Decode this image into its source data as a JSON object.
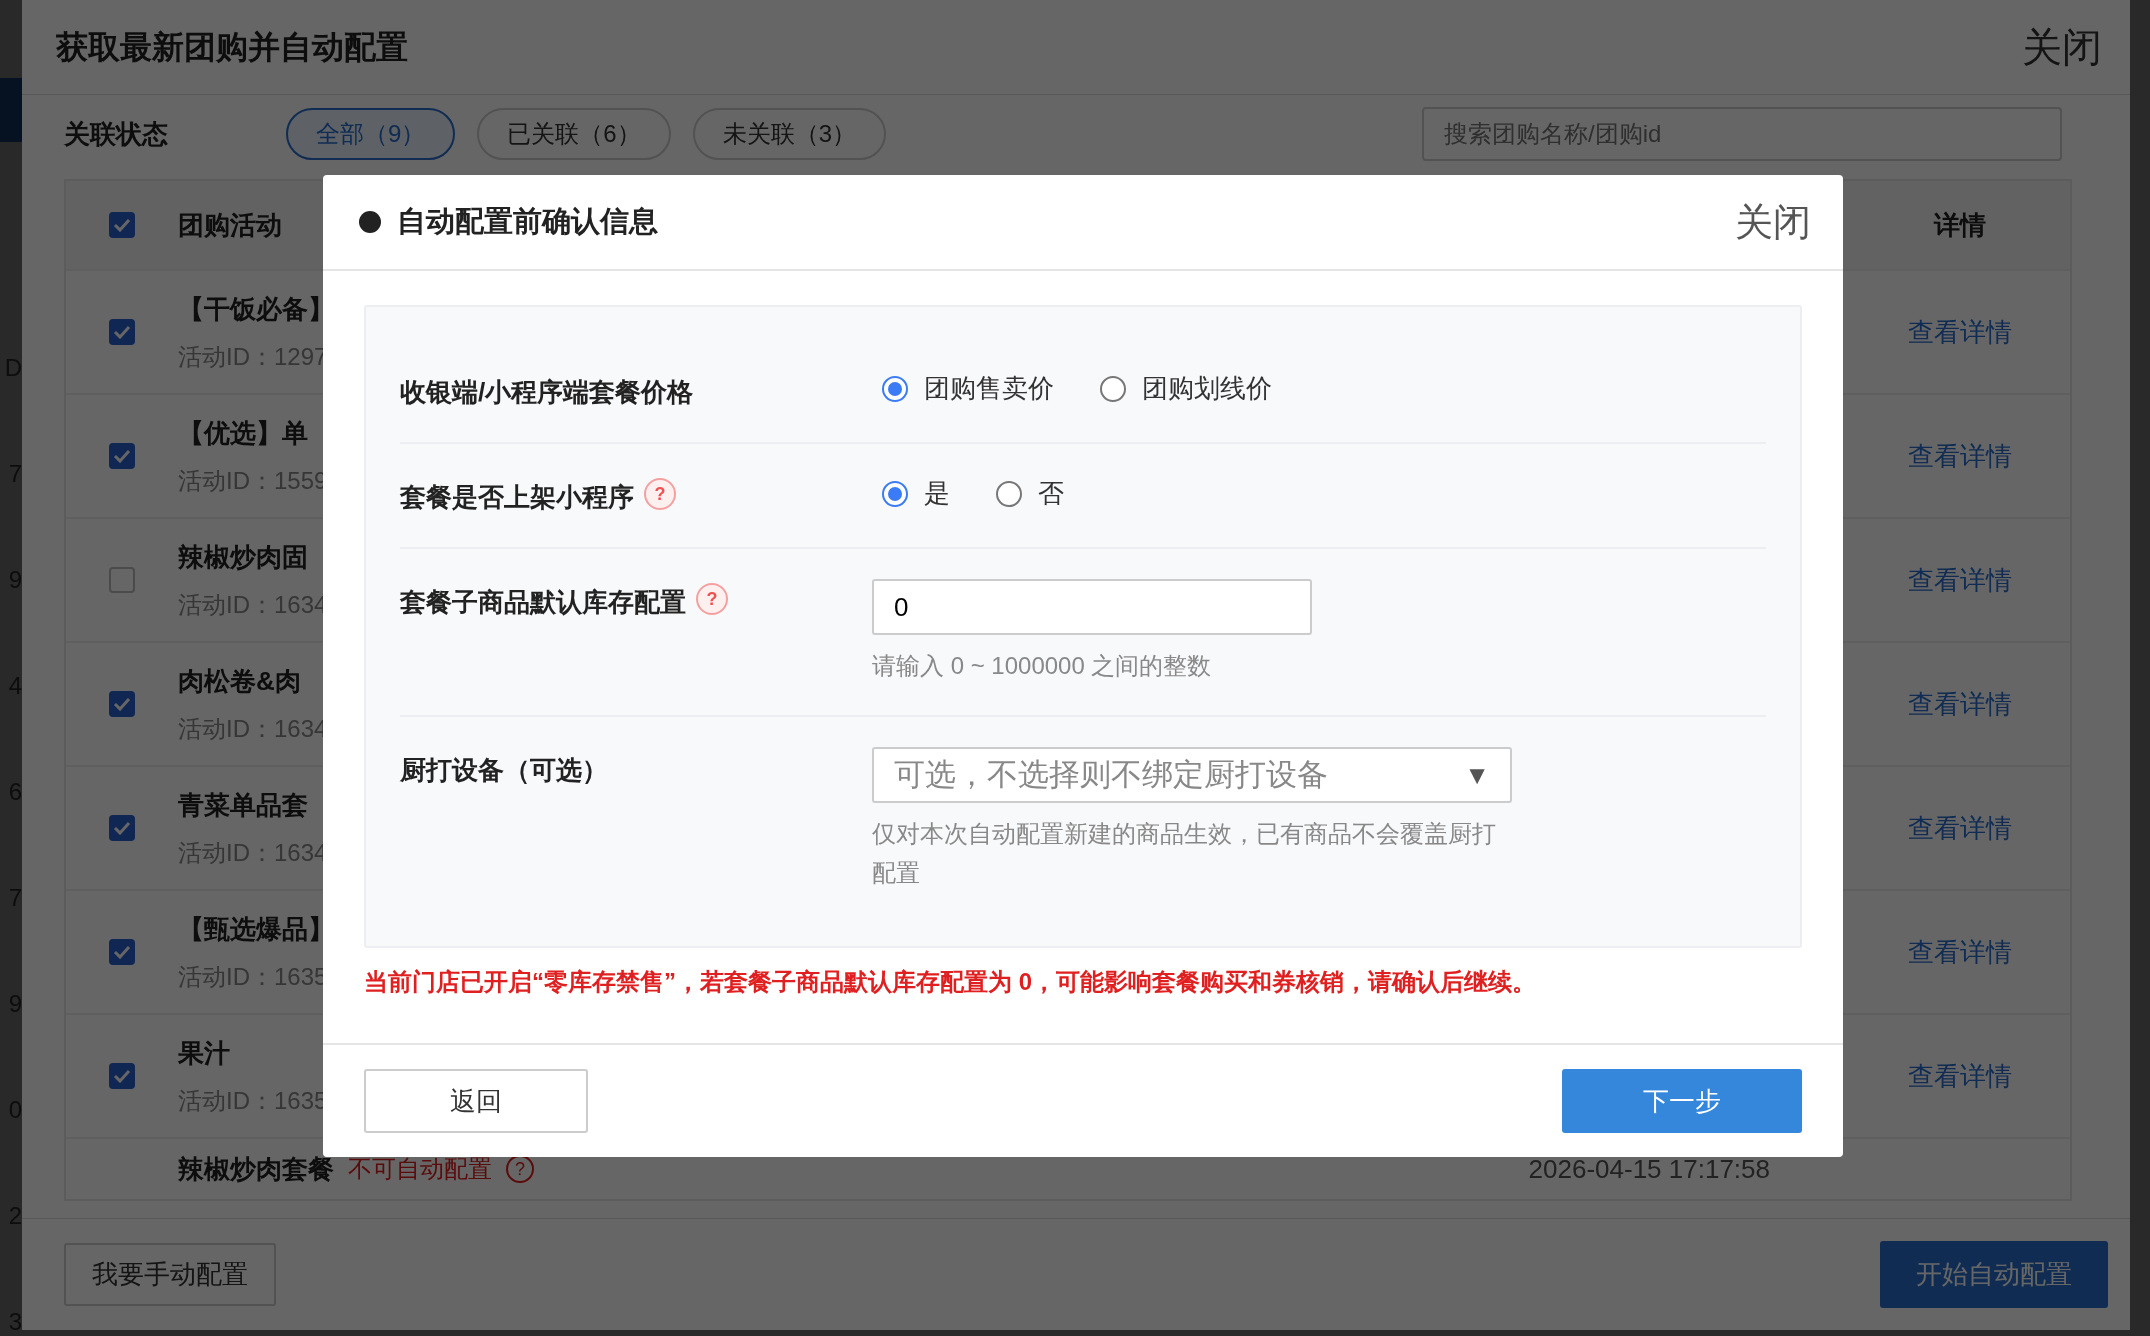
{
  "background_page": {
    "fragments": [
      "D",
      "7",
      "9",
      "4",
      "6",
      "7",
      "9",
      "0",
      "2",
      "3"
    ]
  },
  "dialog": {
    "title": "获取最新团购并自动配置",
    "close": "关闭",
    "filter": {
      "label": "关联状态",
      "tabs": [
        {
          "label": "全部（9）",
          "selected": true
        },
        {
          "label": "已关联（6）",
          "selected": false
        },
        {
          "label": "未关联（3）",
          "selected": false
        }
      ],
      "search": {
        "placeholder": "搜索团购名称/团购id"
      }
    },
    "table": {
      "select_all_checked": true,
      "columns": [
        "团购活动",
        "详情"
      ],
      "rows": [
        {
          "checked": true,
          "name": "【干饭必备】",
          "id": "活动ID：1297",
          "link": "查看详情"
        },
        {
          "checked": true,
          "name": "【优选】单",
          "id": "活动ID：1559",
          "link": "查看详情"
        },
        {
          "checked": false,
          "name": "辣椒炒肉固",
          "id": "活动ID：1634",
          "link": "查看详情"
        },
        {
          "checked": true,
          "name": "肉松卷&肉",
          "id": "活动ID：1634",
          "link": "查看详情"
        },
        {
          "checked": true,
          "name": "青菜单品套",
          "id": "活动ID：1634",
          "link": "查看详情"
        },
        {
          "checked": true,
          "name": "【甄选爆品】",
          "id": "活动ID：1635",
          "link": "查看详情"
        },
        {
          "checked": true,
          "name": "果汁",
          "id": "活动ID：1635",
          "link": "查看详情"
        }
      ],
      "partial_row": {
        "name": "辣椒炒肉套餐",
        "tag": "不可自动配置",
        "help_mark": "?",
        "time": "2026-04-15 17:17:58"
      }
    },
    "footer": {
      "manual_button": "我要手动配置",
      "start_button": "开始自动配置"
    }
  },
  "modal": {
    "title": "自动配置前确认信息",
    "close": "关闭",
    "fields": [
      {
        "kind": "radio",
        "label": "收银端/小程序端套餐价格",
        "options": [
          {
            "label": "团购售卖价",
            "selected": true
          },
          {
            "label": "团购划线价",
            "selected": false
          }
        ]
      },
      {
        "kind": "radio",
        "label": "套餐是否上架小程序",
        "help_mark": "?",
        "options": [
          {
            "label": "是",
            "selected": true
          },
          {
            "label": "否",
            "selected": false
          }
        ]
      },
      {
        "kind": "input",
        "label": "套餐子商品默认库存配置",
        "help_mark": "?",
        "value": "0",
        "hint": "请输入 0 ~ 1000000 之间的整数"
      },
      {
        "kind": "select",
        "label": "厨打设备（可选）",
        "placeholder": "可选，不选择则不绑定厨打设备",
        "caret": "▼",
        "hint": "仅对本次自动配置新建的商品生效，已有商品不会覆盖厨打配置"
      }
    ],
    "warning": "当前门店已开启“零库存禁售”，若套餐子商品默认库存配置为 0，可能影响套餐购买和券核销，请确认后继续。",
    "back_button": "返回",
    "next_button": "下一步"
  }
}
